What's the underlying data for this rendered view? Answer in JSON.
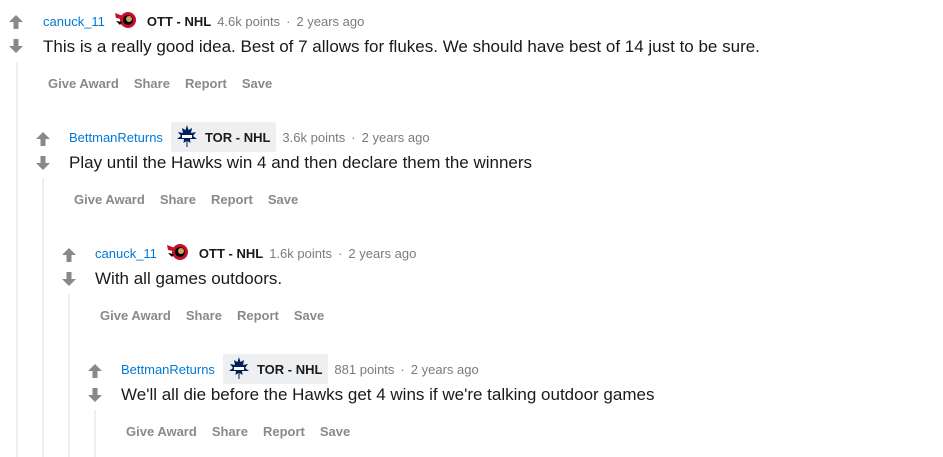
{
  "comments": [
    {
      "username": "canuck_11",
      "flair_text": "OTT - NHL",
      "flair_icon": "senators-logo-icon",
      "points": "4.6k points",
      "age": "2 years ago",
      "body": "This is a really good idea. Best of 7 allows for flukes. We should have best of 14 just to be sure."
    },
    {
      "username": "BettmanReturns",
      "flair_text": "TOR - NHL",
      "flair_icon": "maple-leafs-logo-icon",
      "points": "3.6k points",
      "age": "2 years ago",
      "body": "Play until the Hawks win 4 and then declare them the winners"
    },
    {
      "username": "canuck_11",
      "flair_text": "OTT - NHL",
      "flair_icon": "senators-logo-icon",
      "points": "1.6k points",
      "age": "2 years ago",
      "body": "With all games outdoors."
    },
    {
      "username": "BettmanReturns",
      "flair_text": "TOR - NHL",
      "flair_icon": "maple-leafs-logo-icon",
      "points": "881 points",
      "age": "2 years ago",
      "body": "We'll all die before the Hawks get 4 wins if we're talking outdoor games"
    }
  ],
  "actions": {
    "give_award": "Give Award",
    "share": "Share",
    "report": "Report",
    "save": "Save"
  },
  "separator": "·",
  "colors": {
    "username": "#0079d3",
    "meta": "#787c7e",
    "action": "#878a8c",
    "thread_line": "#edeff1",
    "vote_arrow": "#878a8c"
  }
}
